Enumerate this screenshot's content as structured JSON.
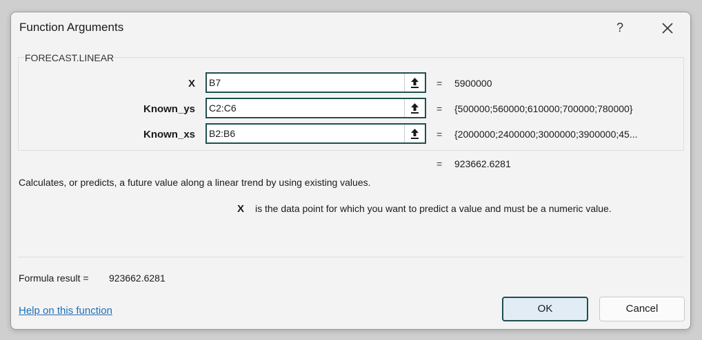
{
  "dialog": {
    "title": "Function Arguments",
    "help_symbol": "?",
    "close_icon": "close-icon"
  },
  "function": {
    "name": "FORECAST.LINEAR",
    "arguments": [
      {
        "label": "X",
        "input_value": "B7",
        "evaluated": "5900000"
      },
      {
        "label": "Known_ys",
        "input_value": "C2:C6",
        "evaluated": "{500000;560000;610000;700000;780000}"
      },
      {
        "label": "Known_xs",
        "input_value": "B2:B6",
        "evaluated": "{2000000;2400000;3000000;3900000;45..."
      }
    ],
    "equals": "=",
    "result_preview": "923662.6281",
    "description": "Calculates, or predicts, a future value along a linear trend by using existing values.",
    "current_arg_name": "X",
    "current_arg_help": "is the data point for which you want to predict a value and must be a numeric value."
  },
  "footer": {
    "formula_result_label": "Formula result =",
    "formula_result_value": "923662.6281",
    "help_link": "Help on this function",
    "ok_label": "OK",
    "cancel_label": "Cancel"
  }
}
